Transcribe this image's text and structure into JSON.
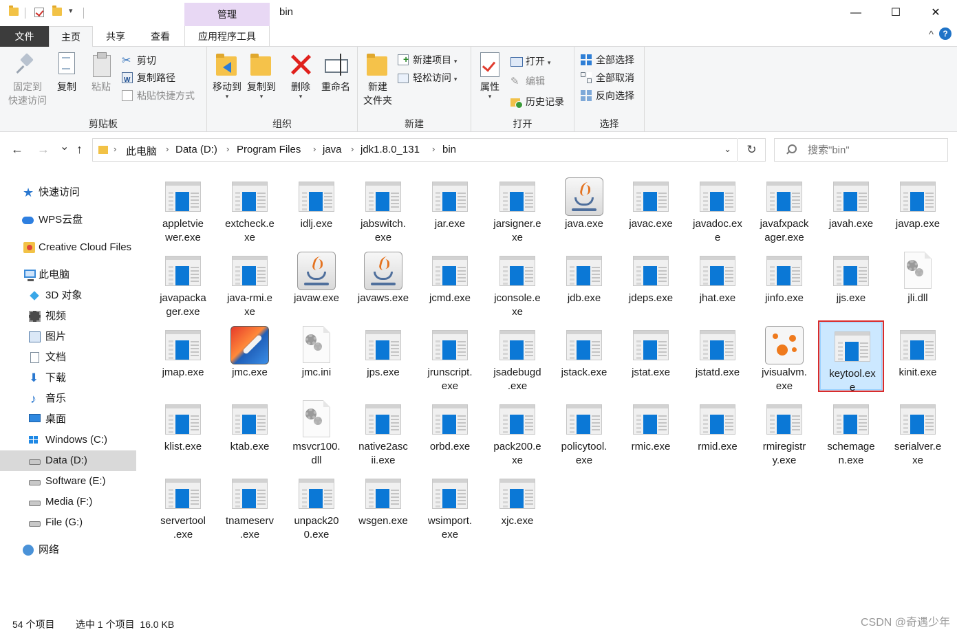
{
  "window": {
    "title": "bin",
    "context_tab_group": "管理",
    "controls": {
      "minimize": "—",
      "maximize": "☐",
      "close": "✕"
    }
  },
  "ribbon_tabs": [
    {
      "label": "文件"
    },
    {
      "label": "主页"
    },
    {
      "label": "共享"
    },
    {
      "label": "查看"
    },
    {
      "label": "应用程序工具"
    }
  ],
  "ribbon_extra": {
    "collapse": "^",
    "help": "?"
  },
  "ribbon": {
    "clipboard": {
      "label": "剪贴板",
      "pin": "固定到\n快速访问",
      "pin_line1": "固定到",
      "pin_line2": "快速访问",
      "copy": "复制",
      "paste": "粘贴",
      "cut": "剪切",
      "copy_path": "复制路径",
      "paste_shortcut": "粘贴快捷方式"
    },
    "organize": {
      "label": "组织",
      "move_to": "移动到",
      "copy_to": "复制到",
      "delete": "删除",
      "rename": "重命名"
    },
    "new": {
      "label": "新建",
      "new_folder_line1": "新建",
      "new_folder_line2": "文件夹",
      "new_item": "新建项目",
      "easy_access": "轻松访问"
    },
    "open": {
      "label": "打开",
      "properties": "属性",
      "open": "打开",
      "edit": "编辑",
      "history": "历史记录"
    },
    "select": {
      "label": "选择",
      "select_all": "全部选择",
      "select_none": "全部取消",
      "invert": "反向选择"
    }
  },
  "nav": {
    "back": "←",
    "forward": "→",
    "recent": "⌄",
    "up": "↑"
  },
  "breadcrumb": [
    "此电脑",
    "Data (D:)",
    "Program Files",
    "java",
    "jdk1.8.0_131",
    "bin"
  ],
  "refresh": "↻",
  "search": {
    "placeholder": "搜索\"bin\""
  },
  "sidebar": {
    "items": [
      {
        "label": "快速访问"
      },
      {
        "label": "WPS云盘"
      },
      {
        "label": "Creative Cloud Files"
      },
      {
        "label": "此电脑"
      },
      {
        "label": "3D 对象"
      },
      {
        "label": "视频"
      },
      {
        "label": "图片"
      },
      {
        "label": "文档"
      },
      {
        "label": "下载"
      },
      {
        "label": "音乐"
      },
      {
        "label": "桌面"
      },
      {
        "label": "Windows (C:)"
      },
      {
        "label": "Data (D:)"
      },
      {
        "label": "Software (E:)"
      },
      {
        "label": "Media (F:)"
      },
      {
        "label": "File (G:)"
      },
      {
        "label": "网络"
      }
    ],
    "selected": "Data (D:)"
  },
  "files": [
    {
      "name": "appletviewer.exe",
      "label": "appletvie\nwer.exe",
      "icon": "exe"
    },
    {
      "name": "extcheck.exe",
      "label": "extcheck.e\nxe",
      "icon": "exe"
    },
    {
      "name": "idlj.exe",
      "label": "idlj.exe",
      "icon": "exe"
    },
    {
      "name": "jabswitch.exe",
      "label": "jabswitch.\nexe",
      "icon": "exe"
    },
    {
      "name": "jar.exe",
      "label": "jar.exe",
      "icon": "exe"
    },
    {
      "name": "jarsigner.exe",
      "label": "jarsigner.e\nxe",
      "icon": "exe"
    },
    {
      "name": "java.exe",
      "label": "java.exe",
      "icon": "java"
    },
    {
      "name": "javac.exe",
      "label": "javac.exe",
      "icon": "exe"
    },
    {
      "name": "javadoc.exe",
      "label": "javadoc.ex\ne",
      "icon": "exe"
    },
    {
      "name": "javafxpackager.exe",
      "label": "javafxpack\nager.exe",
      "icon": "exe"
    },
    {
      "name": "javah.exe",
      "label": "javah.exe",
      "icon": "exe"
    },
    {
      "name": "javap.exe",
      "label": "javap.exe",
      "icon": "exe"
    },
    {
      "name": "javapackager.exe",
      "label": "javapacka\nger.exe",
      "icon": "exe"
    },
    {
      "name": "java-rmi.exe",
      "label": "java-rmi.e\nxe",
      "icon": "exe"
    },
    {
      "name": "javaw.exe",
      "label": "javaw.exe",
      "icon": "java"
    },
    {
      "name": "javaws.exe",
      "label": "javaws.exe",
      "icon": "java"
    },
    {
      "name": "jcmd.exe",
      "label": "jcmd.exe",
      "icon": "exe"
    },
    {
      "name": "jconsole.exe",
      "label": "jconsole.e\nxe",
      "icon": "exe"
    },
    {
      "name": "jdb.exe",
      "label": "jdb.exe",
      "icon": "exe"
    },
    {
      "name": "jdeps.exe",
      "label": "jdeps.exe",
      "icon": "exe"
    },
    {
      "name": "jhat.exe",
      "label": "jhat.exe",
      "icon": "exe"
    },
    {
      "name": "jinfo.exe",
      "label": "jinfo.exe",
      "icon": "exe"
    },
    {
      "name": "jjs.exe",
      "label": "jjs.exe",
      "icon": "exe"
    },
    {
      "name": "jli.dll",
      "label": "jli.dll",
      "icon": "config"
    },
    {
      "name": "jmap.exe",
      "label": "jmap.exe",
      "icon": "exe"
    },
    {
      "name": "jmc.exe",
      "label": "jmc.exe",
      "icon": "jmc"
    },
    {
      "name": "jmc.ini",
      "label": "jmc.ini",
      "icon": "config"
    },
    {
      "name": "jps.exe",
      "label": "jps.exe",
      "icon": "exe"
    },
    {
      "name": "jrunscript.exe",
      "label": "jrunscript.\nexe",
      "icon": "exe"
    },
    {
      "name": "jsadebugd.exe",
      "label": "jsadebugd\n.exe",
      "icon": "exe"
    },
    {
      "name": "jstack.exe",
      "label": "jstack.exe",
      "icon": "exe"
    },
    {
      "name": "jstat.exe",
      "label": "jstat.exe",
      "icon": "exe"
    },
    {
      "name": "jstatd.exe",
      "label": "jstatd.exe",
      "icon": "exe"
    },
    {
      "name": "jvisualvm.exe",
      "label": "jvisualvm.\nexe",
      "icon": "jvisualvm"
    },
    {
      "name": "keytool.exe",
      "label": "keytool.ex\ne",
      "icon": "exe",
      "selected": true
    },
    {
      "name": "kinit.exe",
      "label": "kinit.exe",
      "icon": "exe"
    },
    {
      "name": "klist.exe",
      "label": "klist.exe",
      "icon": "exe"
    },
    {
      "name": "ktab.exe",
      "label": "ktab.exe",
      "icon": "exe"
    },
    {
      "name": "msvcr100.dll",
      "label": "msvcr100.\ndll",
      "icon": "config"
    },
    {
      "name": "native2ascii.exe",
      "label": "native2asc\nii.exe",
      "icon": "exe"
    },
    {
      "name": "orbd.exe",
      "label": "orbd.exe",
      "icon": "exe"
    },
    {
      "name": "pack200.exe",
      "label": "pack200.e\nxe",
      "icon": "exe"
    },
    {
      "name": "policytool.exe",
      "label": "policytool.\nexe",
      "icon": "exe"
    },
    {
      "name": "rmic.exe",
      "label": "rmic.exe",
      "icon": "exe"
    },
    {
      "name": "rmid.exe",
      "label": "rmid.exe",
      "icon": "exe"
    },
    {
      "name": "rmiregistry.exe",
      "label": "rmiregistr\ny.exe",
      "icon": "exe"
    },
    {
      "name": "schemagen.exe",
      "label": "schemage\nn.exe",
      "icon": "exe"
    },
    {
      "name": "serialver.exe",
      "label": "serialver.e\nxe",
      "icon": "exe"
    },
    {
      "name": "servertool.exe",
      "label": "servertool\n.exe",
      "icon": "exe"
    },
    {
      "name": "tnameserv.exe",
      "label": "tnameserv\n.exe",
      "icon": "exe"
    },
    {
      "name": "unpack200.exe",
      "label": "unpack20\n0.exe",
      "icon": "exe"
    },
    {
      "name": "wsgen.exe",
      "label": "wsgen.exe",
      "icon": "exe"
    },
    {
      "name": "wsimport.exe",
      "label": "wsimport.\nexe",
      "icon": "exe"
    },
    {
      "name": "xjc.exe",
      "label": "xjc.exe",
      "icon": "exe"
    }
  ],
  "status": {
    "count": "54 个项目",
    "selection": "选中 1 个项目  16.0 KB"
  },
  "watermark": "CSDN @奇遇少年",
  "colors": {
    "accent_blue": "#0b78d6",
    "selection_bg": "#cce8ff",
    "highlight_border": "#d92b2b",
    "context_tab": "#e8d8f4",
    "file_tab": "#3c3c3c"
  }
}
